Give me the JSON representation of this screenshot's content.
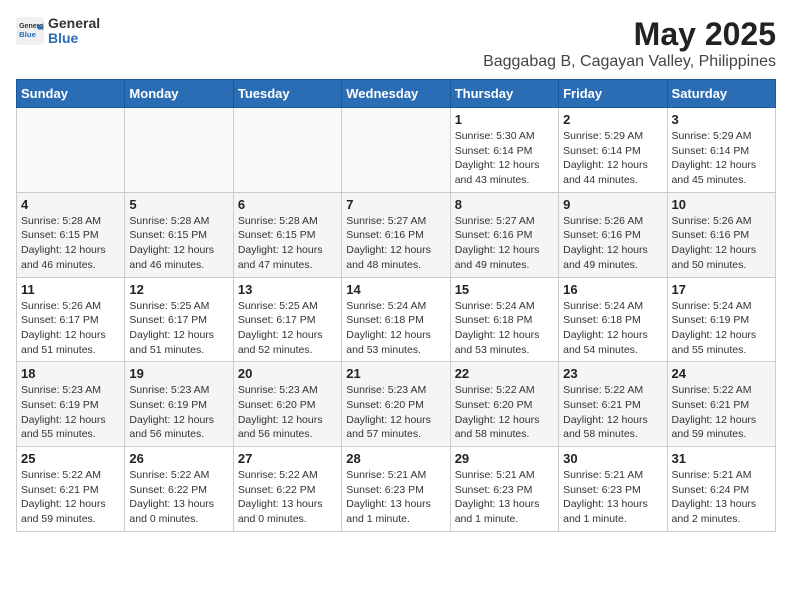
{
  "header": {
    "logo_general": "General",
    "logo_blue": "Blue",
    "title": "May 2025",
    "subtitle": "Baggabag B, Cagayan Valley, Philippines"
  },
  "weekdays": [
    "Sunday",
    "Monday",
    "Tuesday",
    "Wednesday",
    "Thursday",
    "Friday",
    "Saturday"
  ],
  "weeks": [
    [
      {
        "day": "",
        "detail": ""
      },
      {
        "day": "",
        "detail": ""
      },
      {
        "day": "",
        "detail": ""
      },
      {
        "day": "",
        "detail": ""
      },
      {
        "day": "1",
        "detail": "Sunrise: 5:30 AM\nSunset: 6:14 PM\nDaylight: 12 hours\nand 43 minutes."
      },
      {
        "day": "2",
        "detail": "Sunrise: 5:29 AM\nSunset: 6:14 PM\nDaylight: 12 hours\nand 44 minutes."
      },
      {
        "day": "3",
        "detail": "Sunrise: 5:29 AM\nSunset: 6:14 PM\nDaylight: 12 hours\nand 45 minutes."
      }
    ],
    [
      {
        "day": "4",
        "detail": "Sunrise: 5:28 AM\nSunset: 6:15 PM\nDaylight: 12 hours\nand 46 minutes."
      },
      {
        "day": "5",
        "detail": "Sunrise: 5:28 AM\nSunset: 6:15 PM\nDaylight: 12 hours\nand 46 minutes."
      },
      {
        "day": "6",
        "detail": "Sunrise: 5:28 AM\nSunset: 6:15 PM\nDaylight: 12 hours\nand 47 minutes."
      },
      {
        "day": "7",
        "detail": "Sunrise: 5:27 AM\nSunset: 6:16 PM\nDaylight: 12 hours\nand 48 minutes."
      },
      {
        "day": "8",
        "detail": "Sunrise: 5:27 AM\nSunset: 6:16 PM\nDaylight: 12 hours\nand 49 minutes."
      },
      {
        "day": "9",
        "detail": "Sunrise: 5:26 AM\nSunset: 6:16 PM\nDaylight: 12 hours\nand 49 minutes."
      },
      {
        "day": "10",
        "detail": "Sunrise: 5:26 AM\nSunset: 6:16 PM\nDaylight: 12 hours\nand 50 minutes."
      }
    ],
    [
      {
        "day": "11",
        "detail": "Sunrise: 5:26 AM\nSunset: 6:17 PM\nDaylight: 12 hours\nand 51 minutes."
      },
      {
        "day": "12",
        "detail": "Sunrise: 5:25 AM\nSunset: 6:17 PM\nDaylight: 12 hours\nand 51 minutes."
      },
      {
        "day": "13",
        "detail": "Sunrise: 5:25 AM\nSunset: 6:17 PM\nDaylight: 12 hours\nand 52 minutes."
      },
      {
        "day": "14",
        "detail": "Sunrise: 5:24 AM\nSunset: 6:18 PM\nDaylight: 12 hours\nand 53 minutes."
      },
      {
        "day": "15",
        "detail": "Sunrise: 5:24 AM\nSunset: 6:18 PM\nDaylight: 12 hours\nand 53 minutes."
      },
      {
        "day": "16",
        "detail": "Sunrise: 5:24 AM\nSunset: 6:18 PM\nDaylight: 12 hours\nand 54 minutes."
      },
      {
        "day": "17",
        "detail": "Sunrise: 5:24 AM\nSunset: 6:19 PM\nDaylight: 12 hours\nand 55 minutes."
      }
    ],
    [
      {
        "day": "18",
        "detail": "Sunrise: 5:23 AM\nSunset: 6:19 PM\nDaylight: 12 hours\nand 55 minutes."
      },
      {
        "day": "19",
        "detail": "Sunrise: 5:23 AM\nSunset: 6:19 PM\nDaylight: 12 hours\nand 56 minutes."
      },
      {
        "day": "20",
        "detail": "Sunrise: 5:23 AM\nSunset: 6:20 PM\nDaylight: 12 hours\nand 56 minutes."
      },
      {
        "day": "21",
        "detail": "Sunrise: 5:23 AM\nSunset: 6:20 PM\nDaylight: 12 hours\nand 57 minutes."
      },
      {
        "day": "22",
        "detail": "Sunrise: 5:22 AM\nSunset: 6:20 PM\nDaylight: 12 hours\nand 58 minutes."
      },
      {
        "day": "23",
        "detail": "Sunrise: 5:22 AM\nSunset: 6:21 PM\nDaylight: 12 hours\nand 58 minutes."
      },
      {
        "day": "24",
        "detail": "Sunrise: 5:22 AM\nSunset: 6:21 PM\nDaylight: 12 hours\nand 59 minutes."
      }
    ],
    [
      {
        "day": "25",
        "detail": "Sunrise: 5:22 AM\nSunset: 6:21 PM\nDaylight: 12 hours\nand 59 minutes."
      },
      {
        "day": "26",
        "detail": "Sunrise: 5:22 AM\nSunset: 6:22 PM\nDaylight: 13 hours\nand 0 minutes."
      },
      {
        "day": "27",
        "detail": "Sunrise: 5:22 AM\nSunset: 6:22 PM\nDaylight: 13 hours\nand 0 minutes."
      },
      {
        "day": "28",
        "detail": "Sunrise: 5:21 AM\nSunset: 6:23 PM\nDaylight: 13 hours\nand 1 minute."
      },
      {
        "day": "29",
        "detail": "Sunrise: 5:21 AM\nSunset: 6:23 PM\nDaylight: 13 hours\nand 1 minute."
      },
      {
        "day": "30",
        "detail": "Sunrise: 5:21 AM\nSunset: 6:23 PM\nDaylight: 13 hours\nand 1 minute."
      },
      {
        "day": "31",
        "detail": "Sunrise: 5:21 AM\nSunset: 6:24 PM\nDaylight: 13 hours\nand 2 minutes."
      }
    ]
  ]
}
